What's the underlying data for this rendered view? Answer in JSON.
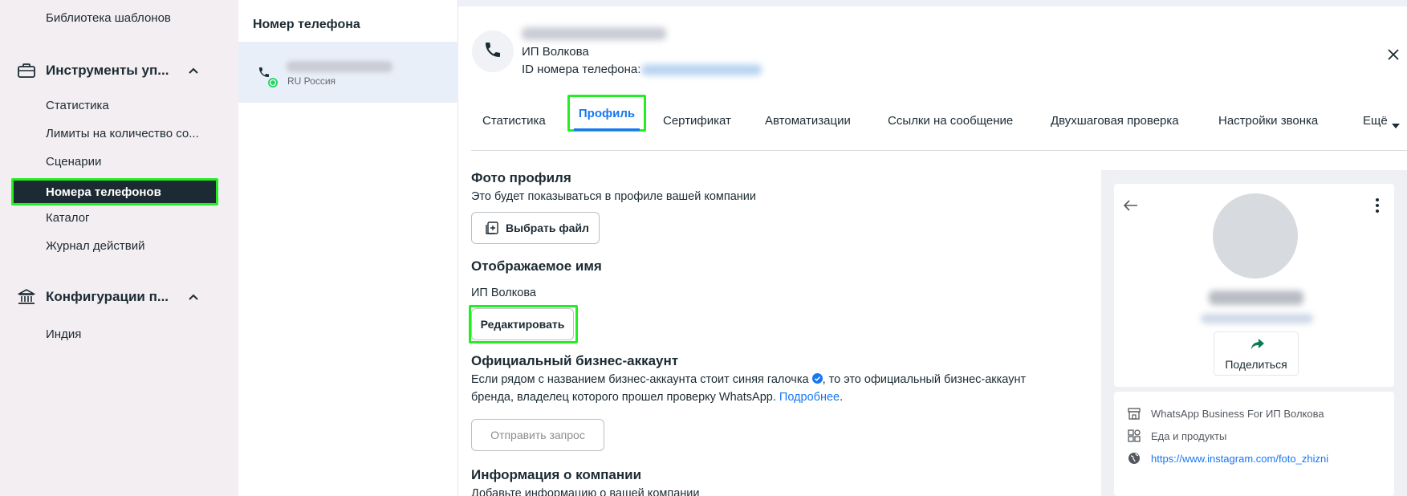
{
  "sidebar": {
    "templates_label": "Библиотека шаблонов",
    "tools_section": {
      "label": "Инструменты уп..."
    },
    "tools_items": [
      "Статистика",
      "Лимиты на количество со...",
      "Сценарии",
      "Номера телефонов",
      "Каталог",
      "Журнал действий"
    ],
    "config_section": {
      "label": "Конфигурации п..."
    },
    "config_items": [
      "Индия"
    ]
  },
  "phone_list": {
    "title": "Номер телефона",
    "items": [
      {
        "country": "RU Россия"
      }
    ]
  },
  "header": {
    "name": "ИП Волкова",
    "id_label": "ID номера телефона:"
  },
  "tabs": {
    "items": [
      "Статистика",
      "Профиль",
      "Сертификат",
      "Автоматизации",
      "Ссылки на сообщение",
      "Двухшаговая проверка",
      "Настройки звонка",
      "Ещё"
    ],
    "active": "Профиль"
  },
  "profile_photo": {
    "title": "Фото профиля",
    "description": "Это будет показываться в профиле вашей компании",
    "button": "Выбрать файл"
  },
  "display_name": {
    "title": "Отображаемое имя",
    "value": "ИП Волкова",
    "button": "Редактировать"
  },
  "official_account": {
    "title": "Официальный бизнес-аккаунт",
    "text_part1": "Если рядом с названием бизнес-аккаунта стоит синяя галочка",
    "text_part2": ", то это официальный бизнес-аккаунт",
    "text_line2": "бренда, владелец которого прошел проверку WhatsApp.",
    "link": "Подробнее",
    "link_suffix": ".",
    "button": "Отправить запрос"
  },
  "company_info": {
    "title": "Информация о компании",
    "description": "Добавьте информацию о вашей компании"
  },
  "preview": {
    "share_label": "Поделиться",
    "business_name": "WhatsApp Business For ИП Волкова",
    "category": "Еда и продукты",
    "website": "https://www.instagram.com/foto_zhizni"
  },
  "colors": {
    "accent": "#1877f2",
    "highlight": "#22ee22",
    "sidebar_active_bg": "#1c2b33"
  }
}
